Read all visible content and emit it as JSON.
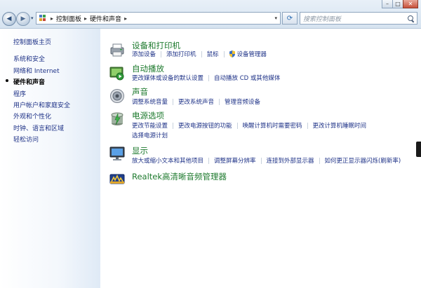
{
  "window": {
    "minimize": "–",
    "maximize": "□",
    "close": "✕"
  },
  "nav": {
    "back": "◀",
    "forward": "▶",
    "dropdown": "▾"
  },
  "address": {
    "separator": "▸",
    "crumbs": [
      "控制面板",
      "硬件和声音"
    ],
    "dropdown": "▾"
  },
  "refresh": "⟳",
  "search": {
    "placeholder": "搜索控制面板"
  },
  "sidebar": {
    "items": [
      {
        "label": "控制面板主页"
      },
      {
        "label": "系统和安全"
      },
      {
        "label": "网络和 Internet"
      },
      {
        "label": "硬件和声音",
        "current": true
      },
      {
        "label": "程序"
      },
      {
        "label": "用户帐户和家庭安全"
      },
      {
        "label": "外观和个性化"
      },
      {
        "label": "时钟、语言和区域"
      },
      {
        "label": "轻松访问"
      }
    ]
  },
  "categories": [
    {
      "title": "设备和打印机",
      "icon": "printer-icon",
      "links": [
        "添加设备",
        "添加打印机",
        "鼠标",
        "设备管理器"
      ]
    },
    {
      "title": "自动播放",
      "icon": "autoplay-icon",
      "links": [
        "更改媒体或设备的默认设置",
        "自动播放 CD 或其他媒体"
      ]
    },
    {
      "title": "声音",
      "icon": "speaker-icon",
      "links": [
        "调整系统音量",
        "更改系统声音",
        "管理音频设备"
      ]
    },
    {
      "title": "电源选项",
      "icon": "power-options-icon",
      "links": [
        "更改节能设置",
        "更改电源按钮的功能",
        "唤醒计算机时需要密码",
        "更改计算机睡眠时间"
      ],
      "links2": [
        "选择电源计划"
      ]
    },
    {
      "title": "显示",
      "icon": "display-icon",
      "links": [
        "放大或缩小文本和其他项目",
        "调整屏幕分辨率",
        "连接到外部显示器",
        "如何更正显示器闪烁(刷新率)"
      ]
    },
    {
      "title": "Realtek高清晰音频管理器",
      "icon": "realtek-audio-icon",
      "links": []
    }
  ],
  "colors": {
    "category_title": "#1e7a2e",
    "link": "#1e3287",
    "sidebar_fade": "#dfeaf6"
  }
}
